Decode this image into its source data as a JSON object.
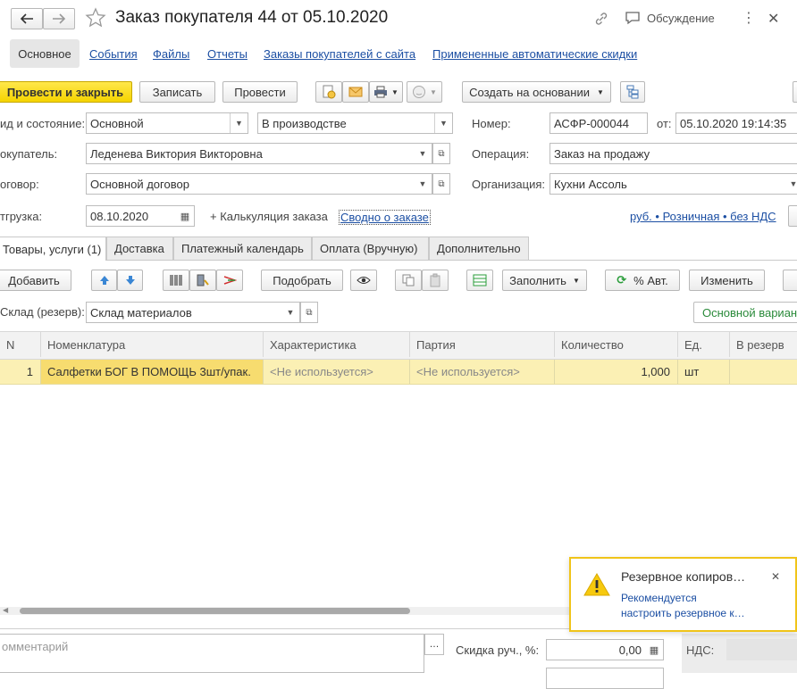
{
  "window": {
    "title": "Заказ покупателя 44 от 05.10.2020",
    "discussion_label": "Обсуждение"
  },
  "nav_tabs": [
    "Основное",
    "События",
    "Файлы",
    "Отчеты",
    "Заказы покупателей с сайта",
    "Примененные автоматические скидки"
  ],
  "toolbar": {
    "post_close": "Провести и закрыть",
    "save": "Записать",
    "post": "Провести",
    "create_based": "Создать на основании"
  },
  "form": {
    "kind_label": "ид и состояние:",
    "kind_value": "Основной",
    "state_value": "В производстве",
    "number_label": "Номер:",
    "number_value": "АСФР-000044",
    "from_label": "от:",
    "date_value": "05.10.2020 19:14:35",
    "customer_label": "окупатель:",
    "customer_value": "Леденева Виктория Викторовна",
    "operation_label": "Операция:",
    "operation_value": "Заказ на продажу",
    "contract_label": "оговор:",
    "contract_value": "Основной договор",
    "org_label": "Организация:",
    "org_value": "Кухни Ассоль",
    "shipment_label": "тгрузка:",
    "shipment_value": "08.10.2020",
    "calc_label": "+ Калькуляция заказа",
    "summary_link": "Сводно о заказе",
    "price_link": "руб. • Розничная • без НДС"
  },
  "inner_tabs": [
    "Товары, услуги (1)",
    "Доставка",
    "Платежный календарь",
    "Оплата (Вручную)",
    "Дополнительно"
  ],
  "table_toolbar": {
    "add": "Добавить",
    "pick": "Подобрать",
    "fill": "Заполнить",
    "auto": "% Авт.",
    "change": "Изменить"
  },
  "warehouse": {
    "label": "Склад (резерв):",
    "value": "Склад материалов",
    "variant": "Основной вариант"
  },
  "table": {
    "headers": [
      "N",
      "Номенклатура",
      "Характеристика",
      "Партия",
      "Количество",
      "Ед.",
      "В резерв"
    ],
    "rows": [
      [
        "1",
        "Салфетки БОГ В ПОМОЩЬ 3шт/упак.",
        "<Не используется>",
        "<Не используется>",
        "1,000",
        "шт",
        ""
      ]
    ]
  },
  "footer": {
    "comment_placeholder": "омментарий",
    "discount_label": "Скидка руч., %:",
    "discount_value": "0,00",
    "vat_label": "НДС:"
  },
  "notification": {
    "title": "Резервное копиров…",
    "text_line1": "Рекомендуется",
    "text_line2": "настроить резервное к…"
  },
  "colors": {
    "accent_yellow": "#f5d400",
    "link_blue": "#1c4fa3",
    "row_selected": "#fbf0b4",
    "notif_border": "#f0c419"
  }
}
